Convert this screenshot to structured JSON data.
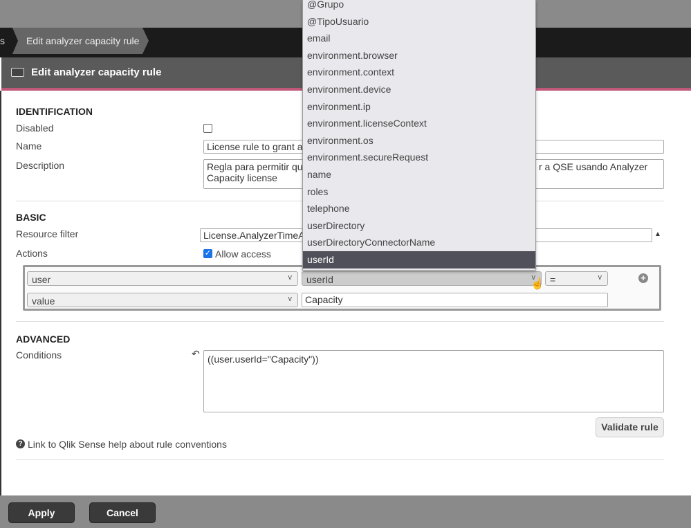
{
  "breadcrumb": {
    "previous": "s",
    "current": "Edit analyzer capacity rule"
  },
  "panel": {
    "title": "Edit analyzer capacity rule",
    "icon": "id-card-icon"
  },
  "identification": {
    "heading": "IDENTIFICATION",
    "disabled_label": "Disabled",
    "disabled": false,
    "name_label": "Name",
    "name_value": "License rule to grant ar",
    "description_label": "Description",
    "description_line1_left": "Regla para permitir qu",
    "description_line1_right": "r a QSE usando Analyzer",
    "description_line2": "Capacity license"
  },
  "basic": {
    "heading": "BASIC",
    "resource_filter_label": "Resource filter",
    "resource_filter_value": "License.AnalyzerTimeA",
    "actions_label": "Actions",
    "allow_access_label": "Allow access",
    "allow_access": true,
    "rule_row1": {
      "object": "user",
      "property": "userId",
      "operator": "="
    },
    "rule_row2": {
      "type": "value",
      "value": "Capacity"
    }
  },
  "advanced": {
    "heading": "ADVANCED",
    "conditions_label": "Conditions",
    "conditions_value": "((user.userId=\"Capacity\"))",
    "validate_label": "Validate rule"
  },
  "help_link": "Link to Qlik Sense help about rule conventions",
  "dropdown": {
    "items": [
      "@Grupo",
      "@TipoUsuario",
      "email",
      "environment.browser",
      "environment.context",
      "environment.device",
      "environment.ip",
      "environment.licenseContext",
      "environment.os",
      "environment.secureRequest",
      "name",
      "roles",
      "telephone",
      "userDirectory",
      "userDirectoryConnectorName",
      "userId"
    ],
    "selected": "userId"
  },
  "footer": {
    "apply_label": "Apply",
    "cancel_label": "Cancel"
  },
  "colors": {
    "accent": "#c0587a",
    "header": "#5a5a5a",
    "selected_item": "#50505a"
  }
}
